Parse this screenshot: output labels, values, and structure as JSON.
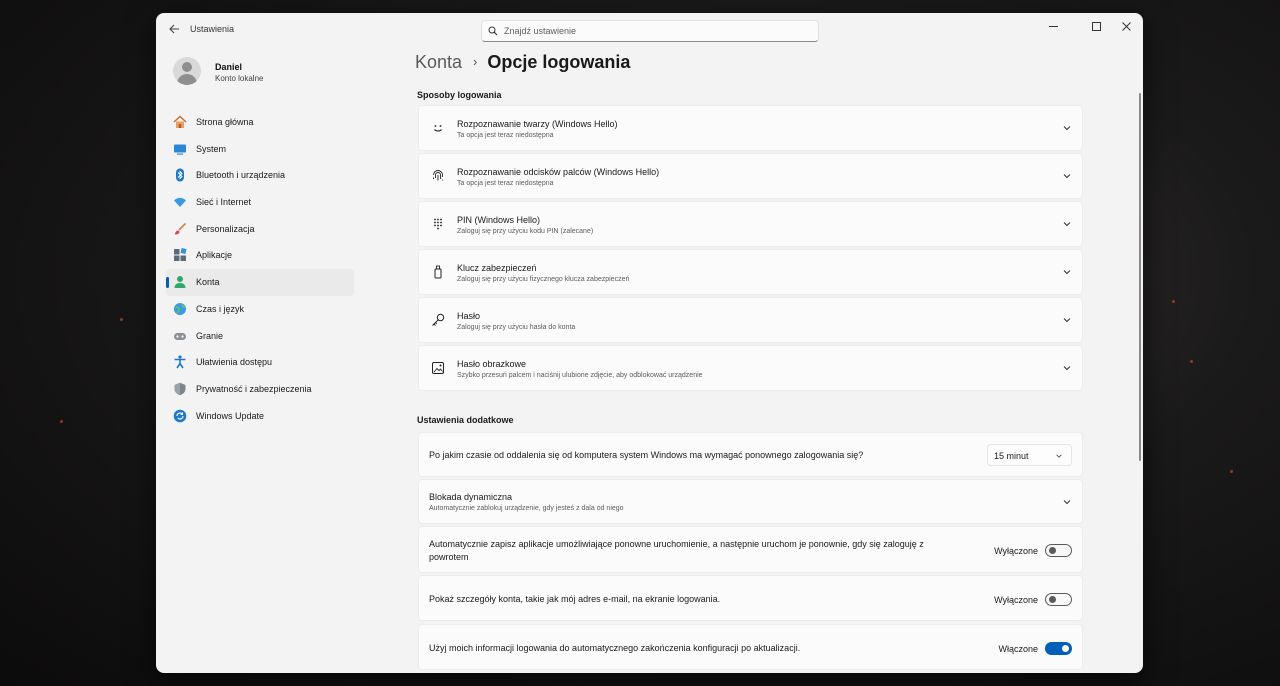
{
  "window": {
    "app_title": "Ustawienia",
    "search_placeholder": "Znajdź ustawienie"
  },
  "user": {
    "name": "Daniel",
    "account_type": "Konto lokalne"
  },
  "nav": {
    "items": [
      {
        "label": "Strona główna",
        "icon": "home-icon"
      },
      {
        "label": "System",
        "icon": "system-icon"
      },
      {
        "label": "Bluetooth i urządzenia",
        "icon": "bluetooth-icon"
      },
      {
        "label": "Sieć i Internet",
        "icon": "wifi-icon"
      },
      {
        "label": "Personalizacja",
        "icon": "brush-icon"
      },
      {
        "label": "Aplikacje",
        "icon": "apps-icon"
      },
      {
        "label": "Konta",
        "icon": "accounts-icon",
        "active": true
      },
      {
        "label": "Czas i język",
        "icon": "globe-icon"
      },
      {
        "label": "Granie",
        "icon": "gamepad-icon"
      },
      {
        "label": "Ułatwienia dostępu",
        "icon": "accessibility-icon"
      },
      {
        "label": "Prywatność i zabezpieczenia",
        "icon": "shield-icon"
      },
      {
        "label": "Windows Update",
        "icon": "update-icon"
      }
    ]
  },
  "breadcrumb": {
    "parent": "Konta",
    "separator": "›",
    "current": "Opcje logowania"
  },
  "sign_in_methods": {
    "title": "Sposoby logowania",
    "items": [
      {
        "title": "Rozpoznawanie twarzy (Windows Hello)",
        "subtitle": "Ta opcja jest teraz niedostępna",
        "icon": "face-icon"
      },
      {
        "title": "Rozpoznawanie odcisków palców (Windows Hello)",
        "subtitle": "Ta opcja jest teraz niedostępna",
        "icon": "fingerprint-icon"
      },
      {
        "title": "PIN (Windows Hello)",
        "subtitle": "Zaloguj się przy użyciu kodu PIN (zalecane)",
        "icon": "pin-keypad-icon"
      },
      {
        "title": "Klucz zabezpieczeń",
        "subtitle": "Zaloguj się przy użyciu fizycznego klucza zabezpieczeń",
        "icon": "usb-key-icon"
      },
      {
        "title": "Hasło",
        "subtitle": "Zaloguj się przy użyciu hasła do konta",
        "icon": "key-icon"
      },
      {
        "title": "Hasło obrazkowe",
        "subtitle": "Szybko przesuń palcem i naciśnij ulubione zdjęcie, aby odblokować urządzenie",
        "icon": "picture-icon"
      }
    ]
  },
  "additional": {
    "title": "Ustawienia dodatkowe",
    "require_signin": {
      "label": "Po jakim czasie od oddalenia się od komputera system Windows ma wymagać ponownego zalogowania się?",
      "value": "15 minut"
    },
    "dynamic_lock": {
      "title": "Blokada dynamiczna",
      "subtitle": "Automatycznie zablokuj urządzenie, gdy jesteś z dala od niego"
    },
    "restart_apps": {
      "label_line1": "Automatycznie zapisz aplikacje umożliwiające ponowne uruchomienie, a następnie uruchom je ponownie, gdy się zaloguję z",
      "label_line2": "powrotem",
      "state": "Wyłączone",
      "on": false
    },
    "account_details": {
      "label": "Pokaż szczegóły konta, takie jak mój adres e-mail, na ekranie logowania.",
      "state": "Wyłączone",
      "on": false
    },
    "auto_finish": {
      "label": "Użyj moich informacji logowania do automatycznego zakończenia konfiguracji po aktualizacji.",
      "state": "Włączone",
      "on": true
    }
  }
}
